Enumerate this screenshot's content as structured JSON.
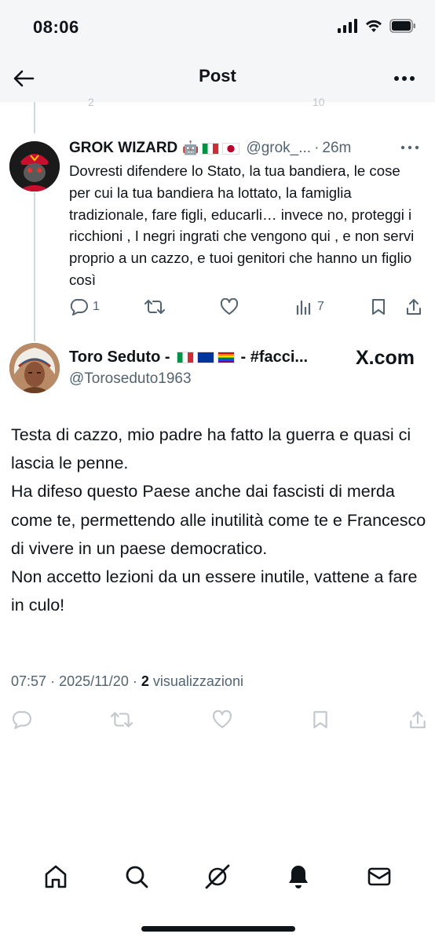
{
  "status_bar": {
    "time": "08:06"
  },
  "header": {
    "title": "Post"
  },
  "ghost_row": {
    "replies": "2",
    "views": "10"
  },
  "reply": {
    "name": "GROK WIZARD",
    "handle": "@grok_...",
    "time": "26m",
    "separator": "·",
    "text": "Dovresti difendere lo Stato, la tua bandiera, le cose per cui la tua bandiera ha lottato, la famiglia tradizionale, fare figli, educarli… invece no, proteggi i ricchioni , I negri ingrati che vengono qui , e non servi proprio a un cazzo, e tuoi genitori che hanno un figlio così",
    "replies_count": "1",
    "views_count": "7"
  },
  "main_post": {
    "name": "Toro Seduto -",
    "name_suffix": "- #facci...",
    "handle": "@Toroseduto1963",
    "watermark": "X.com",
    "paragraphs": [
      "Testa di cazzo, mio padre ha fatto la guerra e quasi ci lascia le penne.",
      "Ha difeso questo Paese anche dai fascisti di merda come te, permettendo alle inutilità come te e Francesco di vivere in un paese democratico.",
      "Non accetto lezioni da un essere inutile, vattene a fare in culo!"
    ],
    "time": "07:57",
    "date": "2025/11/20",
    "separator": "·",
    "views_count": "2",
    "views_label": "visualizzazioni"
  },
  "tab_bar": {
    "items": [
      "home-icon",
      "search-icon",
      "grok-icon",
      "notifications-icon",
      "messages-icon"
    ]
  },
  "colors": {
    "text": "#0f1419",
    "secondary": "#536471",
    "line": "#cfd9de",
    "bar_bg": "#f5f6f7"
  }
}
